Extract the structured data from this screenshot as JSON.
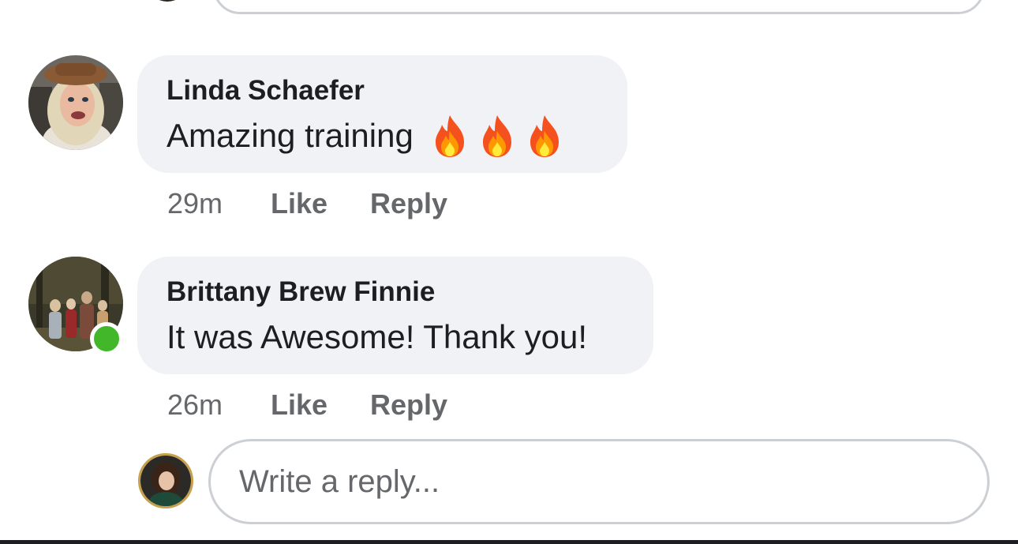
{
  "comments": [
    {
      "author": "Linda Schaefer",
      "text": "Amazing training",
      "emoji": [
        "fire-emoji",
        "fire-emoji",
        "fire-emoji"
      ],
      "time": "29m",
      "like_label": "Like",
      "reply_label": "Reply"
    },
    {
      "author": "Brittany Brew Finnie",
      "text": "It was Awesome! Thank you!",
      "time": "26m",
      "like_label": "Like",
      "reply_label": "Reply",
      "online": true
    }
  ],
  "reply_box": {
    "placeholder": "Write a reply..."
  },
  "colors": {
    "bubble_bg": "#f0f2f5",
    "meta_text": "#65676b",
    "online_green": "#42b72a",
    "input_border": "#ccd0d5"
  }
}
